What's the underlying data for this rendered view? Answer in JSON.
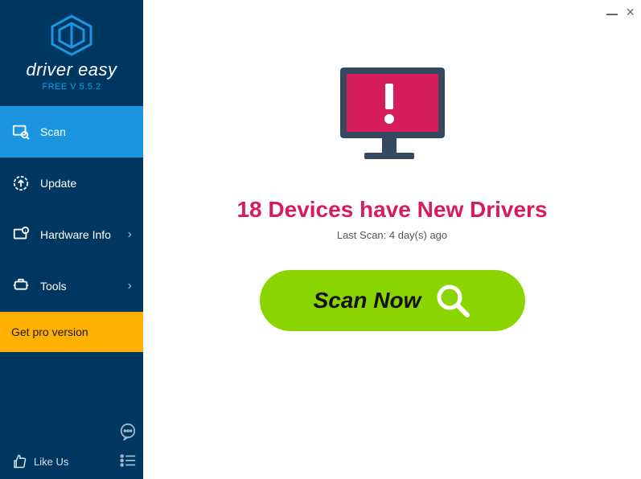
{
  "app": {
    "brand": "driver easy",
    "version_label": "FREE V 5.5.2"
  },
  "sidebar": {
    "items": [
      {
        "label": "Scan"
      },
      {
        "label": "Update"
      },
      {
        "label": "Hardware Info"
      },
      {
        "label": "Tools"
      }
    ],
    "promo_label": "Get pro version",
    "like_label": "Like Us"
  },
  "main": {
    "headline": "18 Devices have New Drivers",
    "subtext": "Last Scan: 4 day(s) ago",
    "scan_button_label": "Scan Now"
  }
}
